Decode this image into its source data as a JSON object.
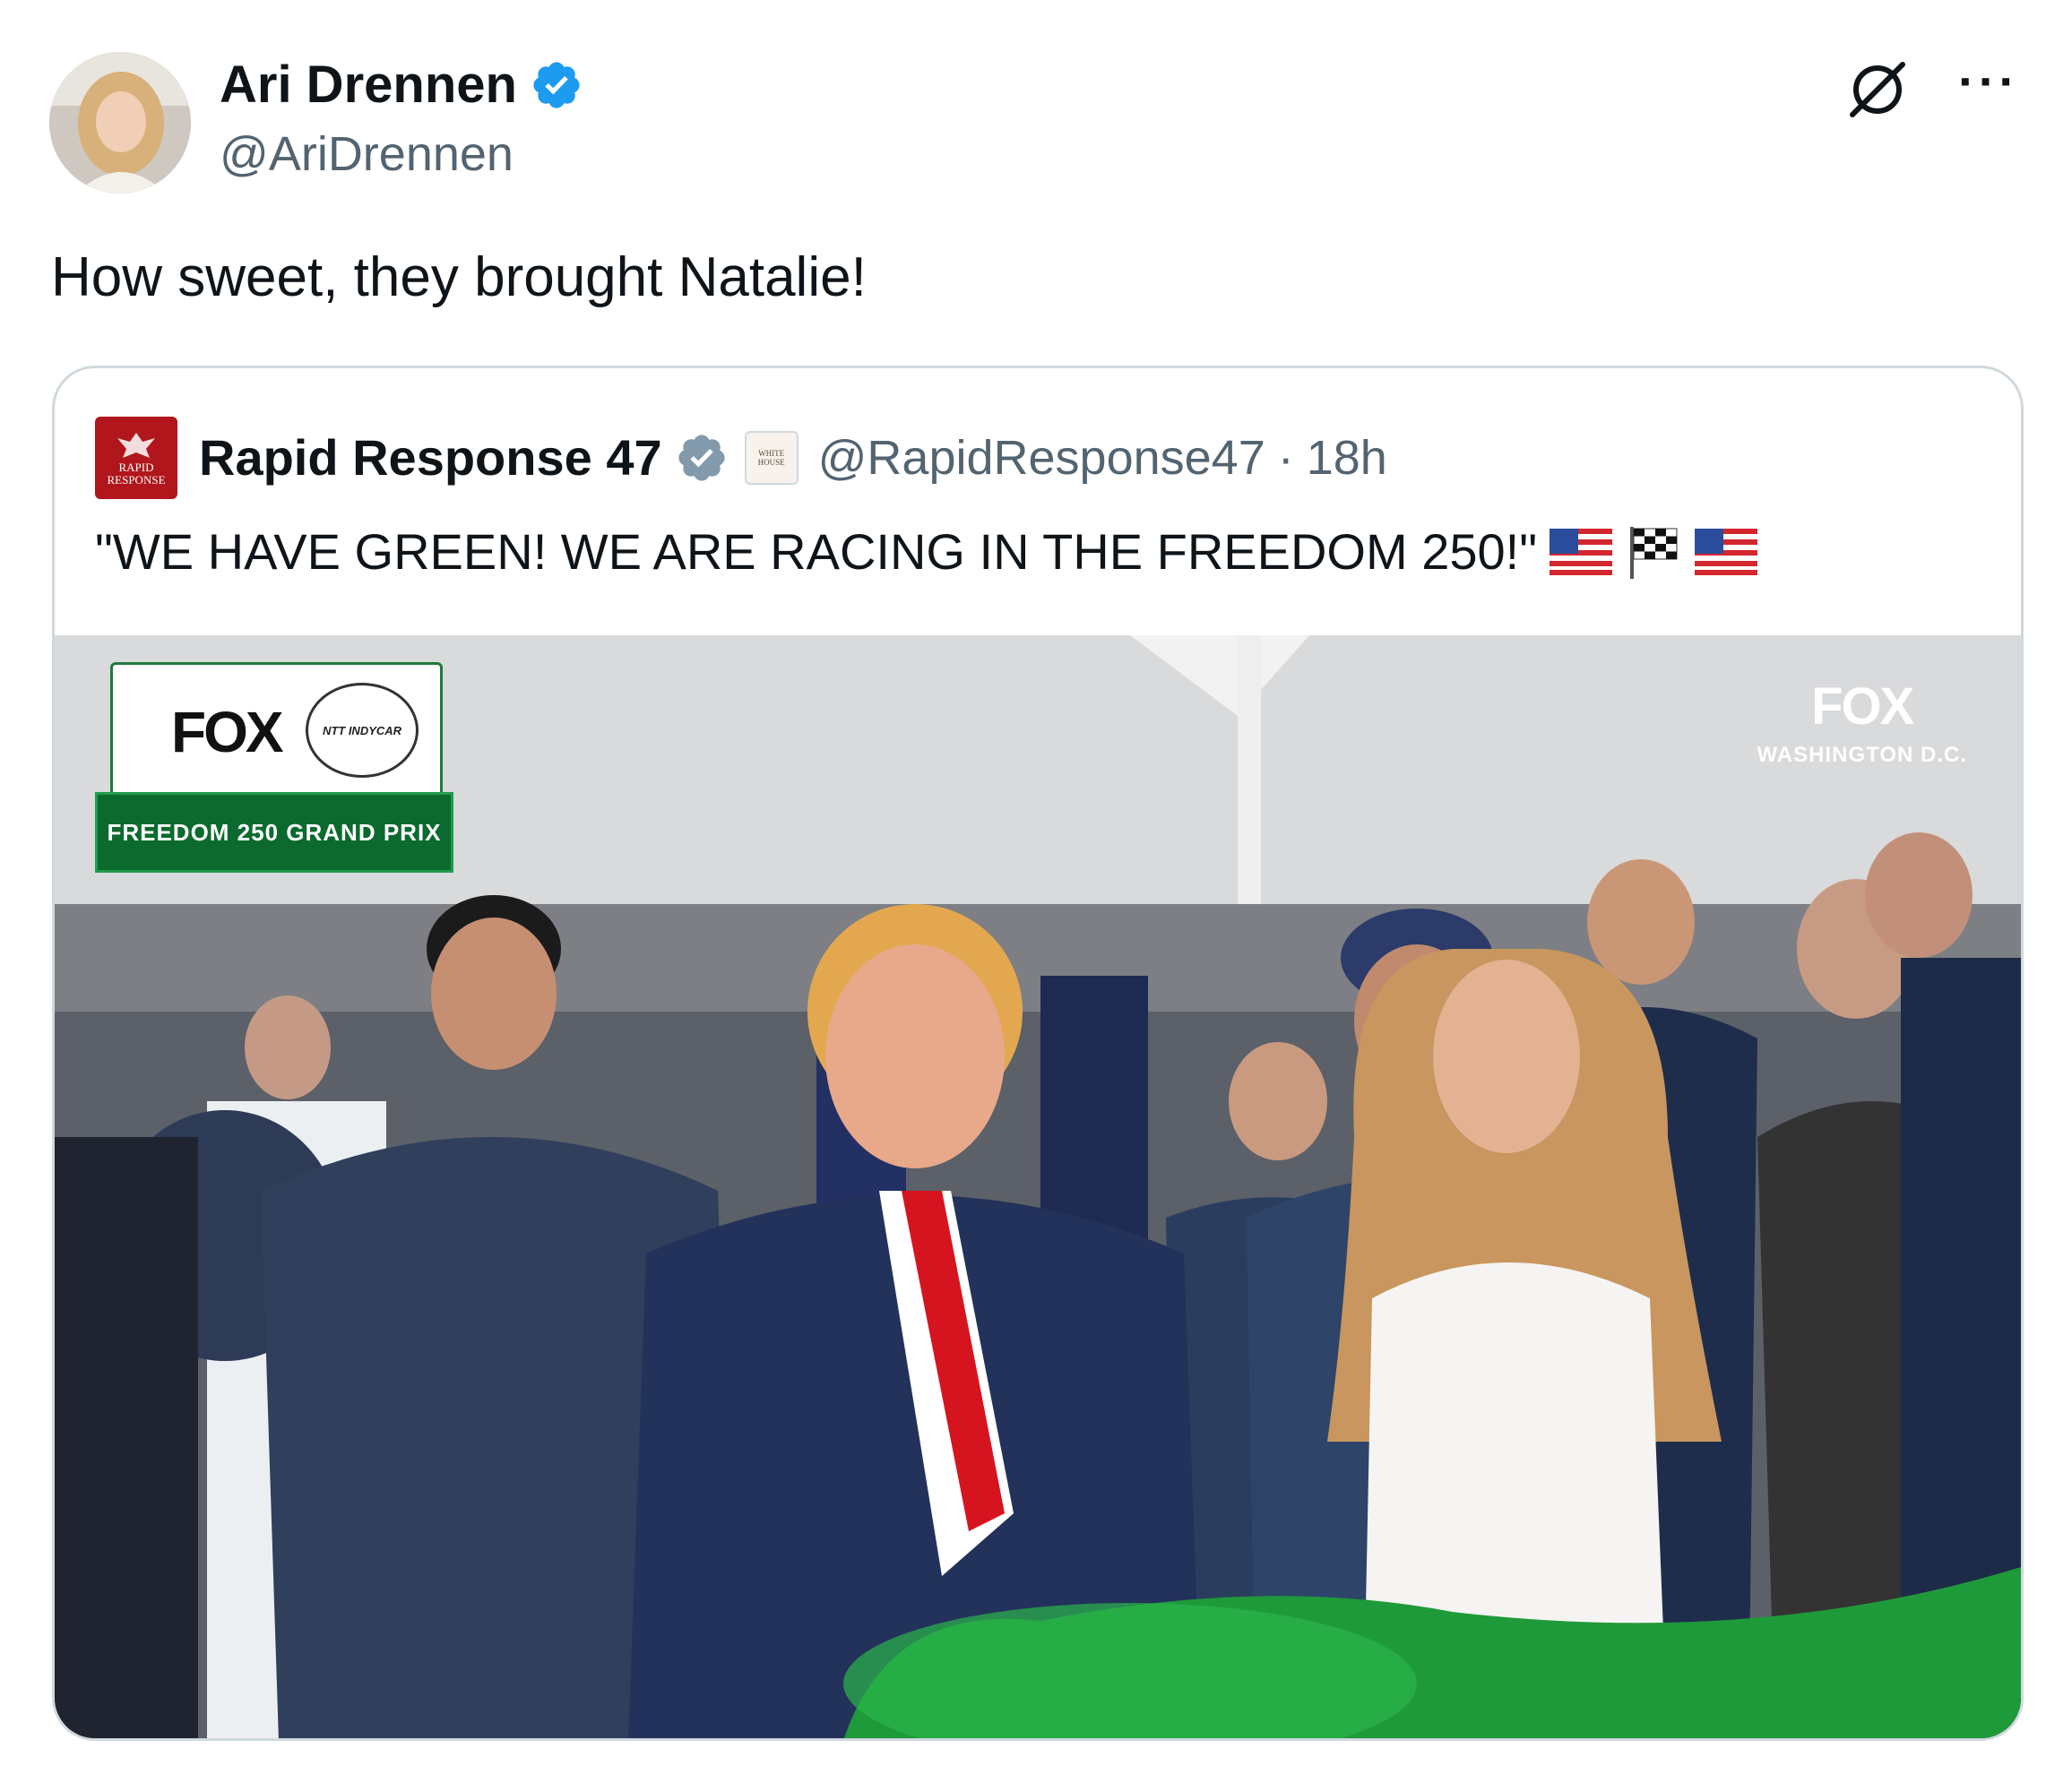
{
  "author": {
    "display_name": "Ari Drennen",
    "handle": "@AriDrennen",
    "verified": true,
    "avatar_icon": "profile-photo"
  },
  "actions": {
    "grok_icon": "grok-icon",
    "more_label": "···"
  },
  "tweet": {
    "text": "How sweet, they brought Natalie!"
  },
  "quoted_tweet": {
    "display_name": "Rapid Response 47",
    "handle": "@RapidResponse47",
    "separator": "·",
    "time": "18h",
    "avatar_label": "RAPID RESPONSE",
    "affiliation_label": "WHITE HOUSE",
    "text": "\"WE HAVE GREEN! WE ARE RACING IN THE FREEDOM 250!\"",
    "emojis": [
      "us-flag-emoji",
      "checkered-flag-emoji",
      "us-flag-emoji"
    ]
  },
  "media": {
    "fox_logo": "FOX",
    "indycar_label": "NTT INDYCAR",
    "race_banner": "FREEDOM 250 GRAND PRIX",
    "corner_logo": "FOX",
    "corner_location": "WASHINGTON D.C."
  },
  "colors": {
    "verified_blue": "#1d9bf0",
    "verified_gray": "#829aab",
    "text_secondary": "#536471",
    "border": "#cfd9de",
    "green_flag": "#1f9a3a"
  }
}
